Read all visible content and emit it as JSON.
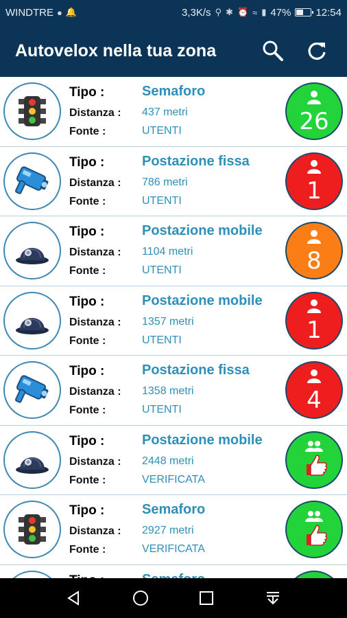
{
  "status": {
    "carrier": "WINDTRE",
    "speed": "3,3K/s",
    "battery": "47%",
    "battery_level": 0.47,
    "time": "12:54"
  },
  "appbar": {
    "title": "Autovelox nella tua zona",
    "search_icon": "search-icon",
    "refresh_icon": "refresh-icon"
  },
  "labels": {
    "tipo": "Tipo :",
    "distanza": "Distanza :",
    "fonte": "Fonte :"
  },
  "items": [
    {
      "type": "Semaforo",
      "distance": "437 metri",
      "source": "UTENTI",
      "icon": "traffic-light-icon",
      "badge_color": "green",
      "badge_kind": "count",
      "count": "26"
    },
    {
      "type": "Postazione fissa",
      "distance": "786 metri",
      "source": "UTENTI",
      "icon": "speed-camera-icon",
      "badge_color": "red",
      "badge_kind": "count",
      "count": "1"
    },
    {
      "type": "Postazione mobile",
      "distance": "1104 metri",
      "source": "UTENTI",
      "icon": "police-helmet-icon",
      "badge_color": "orange",
      "badge_kind": "count",
      "count": "8"
    },
    {
      "type": "Postazione mobile",
      "distance": "1357 metri",
      "source": "UTENTI",
      "icon": "police-helmet-icon",
      "badge_color": "red",
      "badge_kind": "count",
      "count": "1"
    },
    {
      "type": "Postazione fissa",
      "distance": "1358 metri",
      "source": "UTENTI",
      "icon": "speed-camera-icon",
      "badge_color": "red",
      "badge_kind": "count",
      "count": "4"
    },
    {
      "type": "Postazione mobile",
      "distance": "2448 metri",
      "source": "VERIFICATA",
      "icon": "police-helmet-icon",
      "badge_color": "green",
      "badge_kind": "verified",
      "count": ""
    },
    {
      "type": "Semaforo",
      "distance": "2927 metri",
      "source": "VERIFICATA",
      "icon": "traffic-light-icon",
      "badge_color": "green",
      "badge_kind": "verified",
      "count": ""
    },
    {
      "type": "Semaforo",
      "distance": "",
      "source": "",
      "icon": "traffic-light-icon",
      "badge_color": "green",
      "badge_kind": "verified",
      "count": ""
    }
  ],
  "navbar": {
    "back_icon": "back-icon",
    "home_icon": "home-icon",
    "recents_icon": "recents-icon",
    "notifications_icon": "notification-pull-icon"
  }
}
